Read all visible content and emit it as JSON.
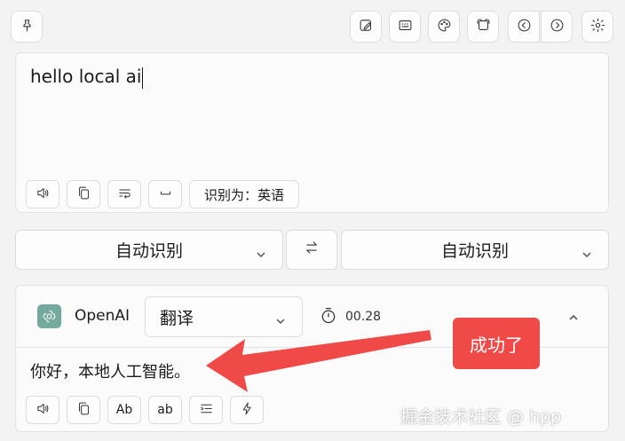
{
  "toolbar": {
    "left_icons": [
      "pin-icon"
    ],
    "right_icons": [
      "edit-image-icon",
      "keyboard-icon",
      "palette-icon",
      "screenshot-icon",
      "back-icon",
      "forward-icon",
      "settings-icon"
    ]
  },
  "source": {
    "text": "hello local ai",
    "detected_label": "识别为：英语",
    "action_icons": [
      "speaker-icon",
      "copy-icon",
      "wrap-text-icon",
      "space-icon"
    ]
  },
  "languages": {
    "from": "自动识别",
    "to": "自动识别",
    "swap_icon": "swap-arrows-icon"
  },
  "result": {
    "service": "OpenAI",
    "mode": "翻译",
    "time": "00.28",
    "text": "你好，本地人工智能。",
    "actions": {
      "speak_icon": "speaker-icon",
      "copy_icon": "copy-icon",
      "capitalize_label": "Ab",
      "lowercase_label": "ab",
      "indent_icon": "indent-icon",
      "lightning_icon": "lightning-icon"
    }
  },
  "annotation": {
    "callout": "成功了",
    "color": "#ef4a48"
  },
  "watermark": "掘金技术社区 @ hpp",
  "colors": {
    "background": "#f3f3f3",
    "card": "#fbfbfb",
    "openai_brand": "#74aa9c"
  }
}
